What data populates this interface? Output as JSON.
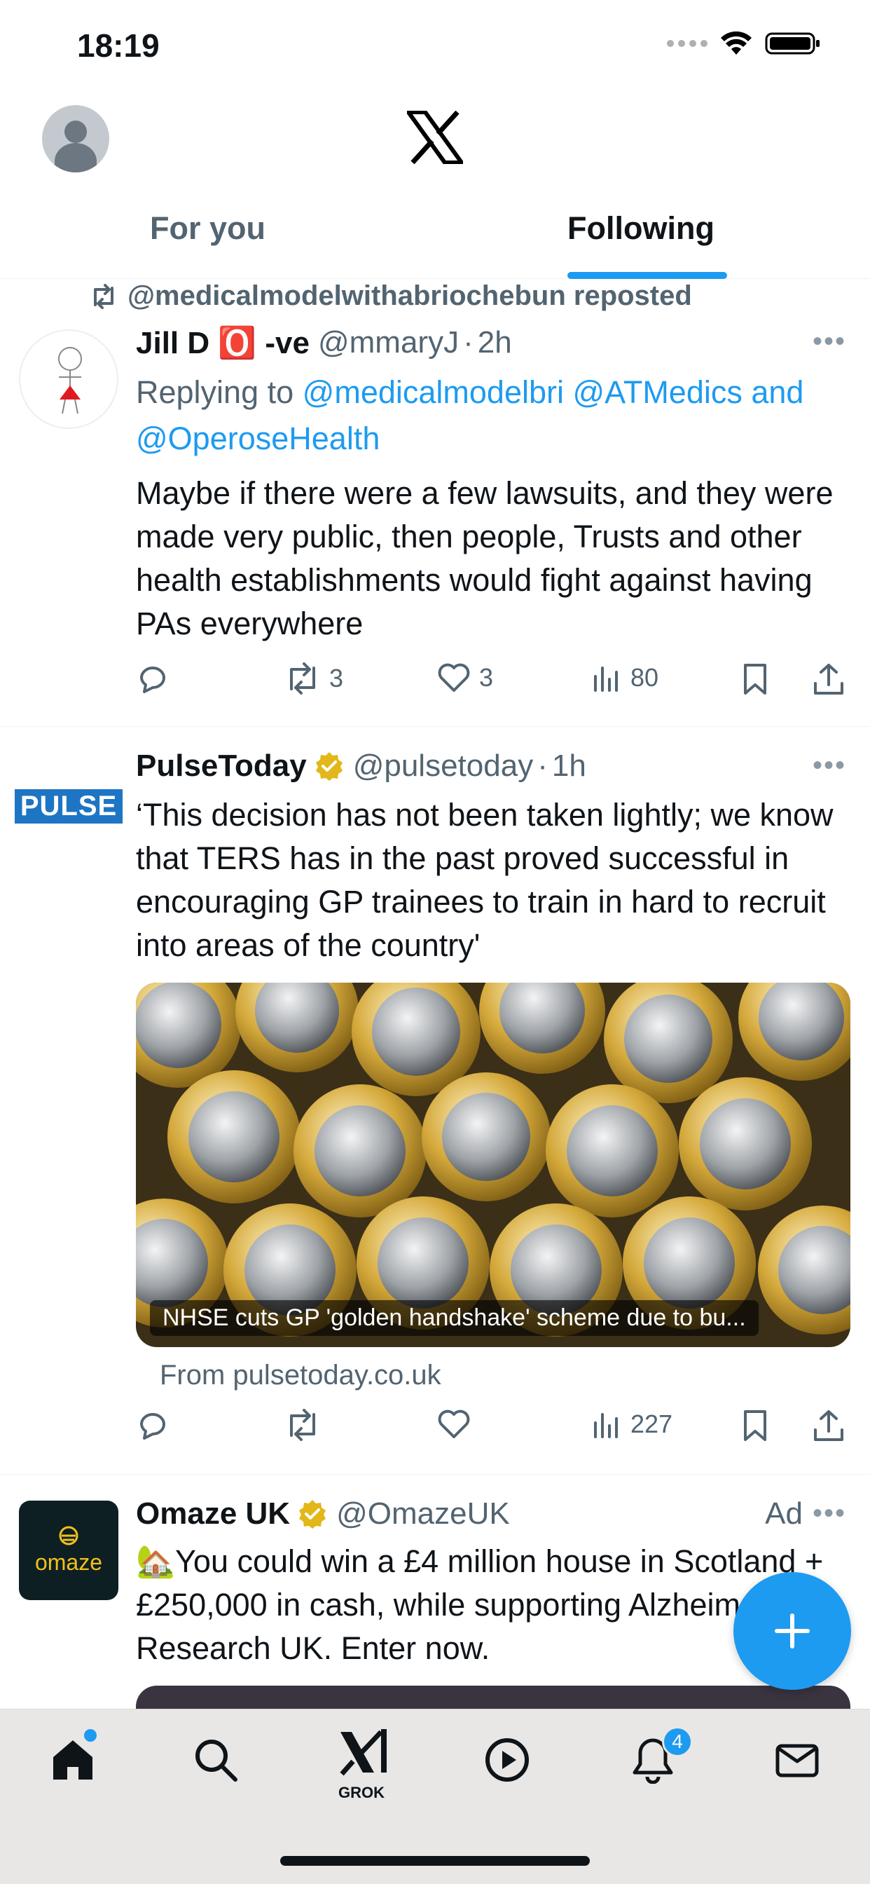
{
  "status_bar": {
    "time": "18:19"
  },
  "tabs": [
    {
      "label": "For you",
      "selected": false
    },
    {
      "label": "Following",
      "selected": true
    }
  ],
  "tweet1": {
    "repost_label": "@medicalmodelwithabriochebun reposted",
    "name": "Jill D 🅾️ -ve",
    "handle": "@mmaryJ",
    "time": "2h",
    "replying_prefix": "Replying to",
    "replying_to": "@medicalmodelbri @ATMedics and",
    "replying_to_2": "@OperoseHealth",
    "text": "Maybe if there were a few lawsuits, and they were made very public, then people, Trusts and other health establishments would fight against having PAs everywhere",
    "reposts": "3",
    "likes": "3",
    "views": "80"
  },
  "tweet2": {
    "avatar_text": "PULSE",
    "name": "PulseToday",
    "handle": "@pulsetoday",
    "time": "1h",
    "text": "‘This decision has not been taken lightly; we know that TERS has in the past proved successful in encouraging GP trainees to train in hard to recruit into areas of the country'",
    "card_caption": "NHSE cuts GP 'golden handshake' scheme due to bu...",
    "card_from": "From pulsetoday.co.uk",
    "views": "227"
  },
  "tweet3": {
    "avatar_text": "omaze",
    "name": "Omaze UK",
    "handle": "@OmazeUK",
    "ad_label": "Ad",
    "text": "🏡You could win a £4 million house in Scotland + £250,000 in cash, while supporting Alzheimer's Research UK. Enter now."
  },
  "bottom_nav": {
    "grok_label": "GROK",
    "notifications_count": "4"
  },
  "colors": {
    "accent": "#1d9bf0",
    "verified_gold": "#e2b719",
    "secondary_text": "#536471"
  }
}
